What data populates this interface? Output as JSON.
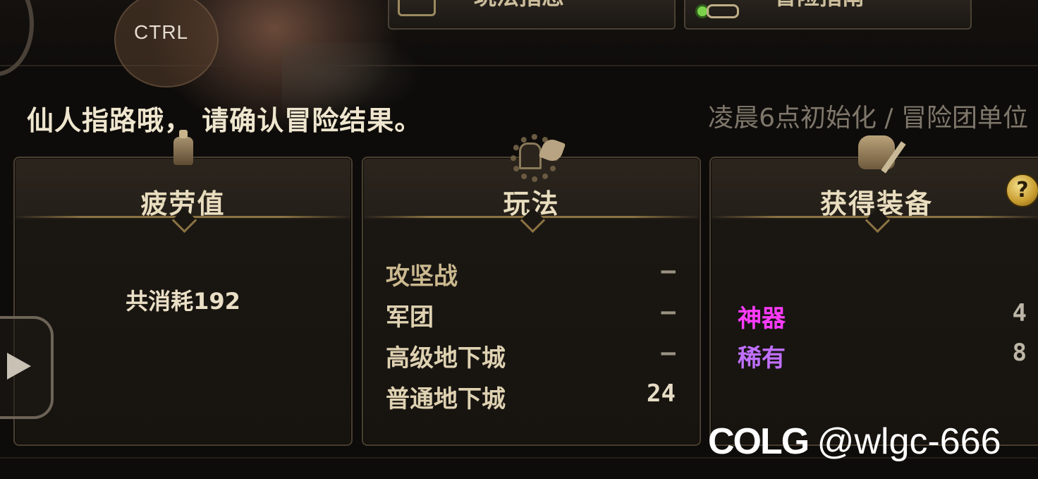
{
  "overlay": {
    "ctrl_label": "CTRL"
  },
  "top_buttons": [
    {
      "label": "玩法指恶",
      "icon": "scroll-icon"
    },
    {
      "label": "冒险指南",
      "icon": "key-icon"
    }
  ],
  "prompt": "仙人指路哦，  请确认冒险结果。",
  "reset_note": "凌晨6点初始化 / 冒险团单位",
  "panels": {
    "fatigue": {
      "title": "疲劳值",
      "text": "共消耗192"
    },
    "modes": {
      "title": "玩法",
      "rows": [
        {
          "name": "攻坚战",
          "value": "–",
          "color": "#cbb98f"
        },
        {
          "name": "军团",
          "value": "–",
          "color": "#dfd2b2"
        },
        {
          "name": "高级地下城",
          "value": "–",
          "color": "#dfd2b2"
        },
        {
          "name": "普通地下城",
          "value": "24",
          "color": "#dfd2b2"
        }
      ]
    },
    "equipment": {
      "title": "获得装备",
      "help": "?",
      "rows": [
        {
          "name": "神器",
          "value": "4",
          "color": "#ff3cff"
        },
        {
          "name": "稀有",
          "value": "8",
          "color": "#c070ff"
        }
      ]
    }
  },
  "watermark": {
    "logo": "COLG",
    "handle": "@wlgc-666"
  }
}
